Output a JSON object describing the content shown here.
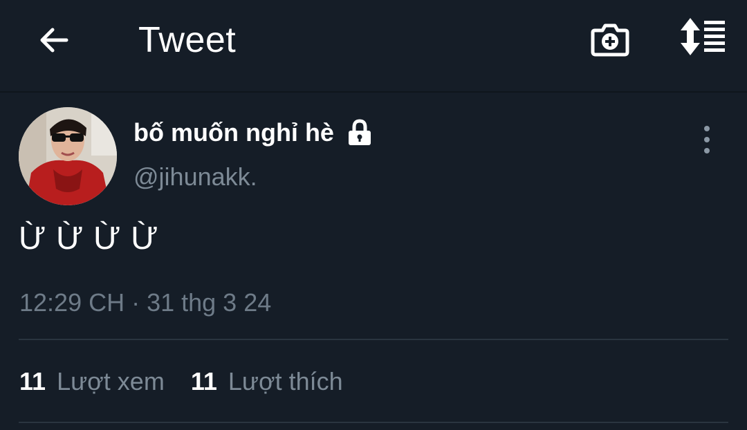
{
  "header": {
    "back_icon": "arrow-left-icon",
    "title": "Tweet",
    "camera_icon": "camera-plus-icon",
    "reorder_icon": "sort-arrows-list-icon"
  },
  "tweet": {
    "display_name": "bố muốn nghỉ hè",
    "protected_icon": "lock-icon",
    "handle": "@jihunakk.",
    "more_icon": "more-vertical-icon",
    "text": "Ừ Ừ Ừ Ừ",
    "timestamp": "12:29 CH · 31 thg 3 24",
    "stats": {
      "views_count": "11",
      "views_label": "Lượt xem",
      "likes_count": "11",
      "likes_label": "Lượt thích"
    }
  },
  "colors": {
    "background": "#151d27",
    "secondary_text": "#7d8a96",
    "divider": "#2a3540"
  }
}
